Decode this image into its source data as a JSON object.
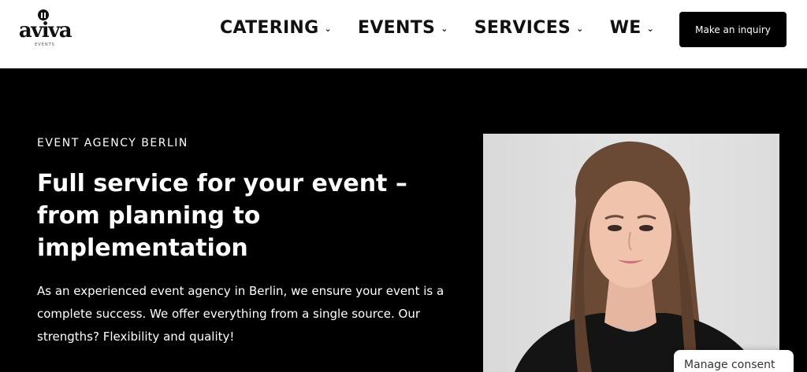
{
  "header": {
    "logo": {
      "word": "aviva",
      "sub": "EVENTS"
    },
    "nav": [
      {
        "label": "CATERING"
      },
      {
        "label": "EVENTS"
      },
      {
        "label": "SERVICES"
      },
      {
        "label": "WE"
      }
    ],
    "chevron_icon": "chevron-down-icon",
    "inquiry_button": "Make an inquiry"
  },
  "hero": {
    "eyebrow": "EVENT AGENCY BERLIN",
    "title": "Full service for your event – from planning to implementation",
    "text": "As an experienced event agency in Berlin, we ensure your event is a complete success. We offer everything from a single source. Our strengths? Flexibility and quality!"
  },
  "consent": {
    "label": "Manage consent"
  },
  "colors": {
    "background": "#000000",
    "header": "#ffffff",
    "text": "#ffffff",
    "button": "#000000"
  }
}
